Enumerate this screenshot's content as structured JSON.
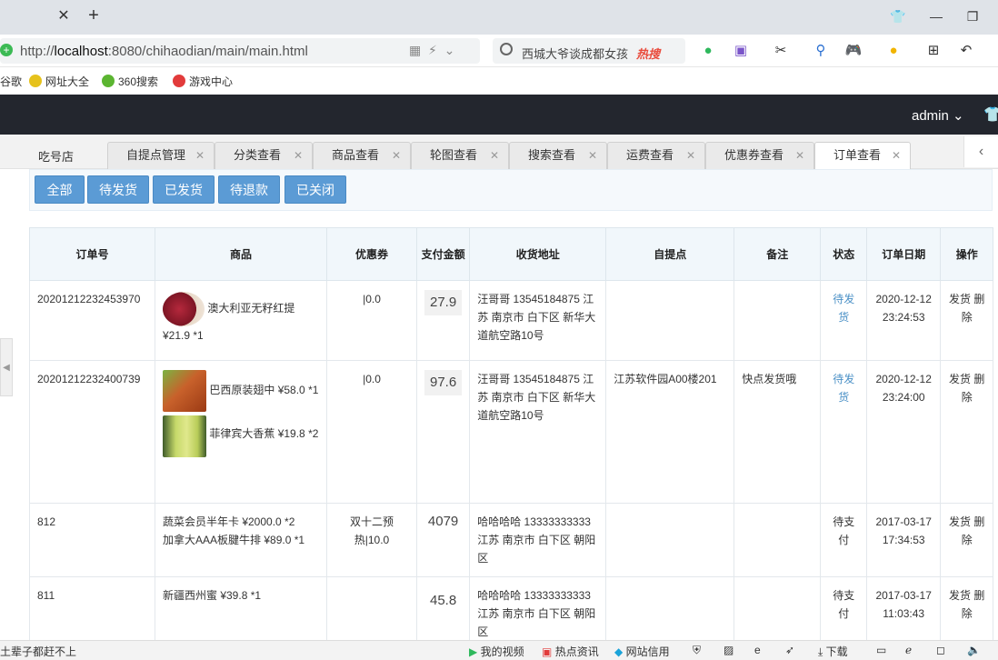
{
  "browser": {
    "url_prefix": "http://",
    "url_host": "localhost",
    "url_rest": ":8080/chihaodian/main/main.html",
    "search_text": "西城大爷谈成都女孩",
    "hot_label": "热搜",
    "bookmarks": [
      "谷歌",
      "网址大全",
      "360搜索",
      "游戏中心"
    ]
  },
  "header": {
    "user": "admin"
  },
  "tabs": {
    "first": "吃号店",
    "items": [
      {
        "label": "自提点管理"
      },
      {
        "label": "分类查看"
      },
      {
        "label": "商品查看"
      },
      {
        "label": "轮图查看"
      },
      {
        "label": "搜索查看"
      },
      {
        "label": "运费查看"
      },
      {
        "label": "优惠券查看"
      },
      {
        "label": "订单查看"
      }
    ]
  },
  "filters": [
    "全部",
    "待发货",
    "已发货",
    "待退款",
    "已关闭"
  ],
  "table": {
    "headers": [
      "订单号",
      "商品",
      "优惠券",
      "支付金额",
      "收货地址",
      "自提点",
      "备注",
      "状态",
      "订单日期",
      "操作"
    ],
    "rows": [
      {
        "order_no": "20201212232453970",
        "products": [
          {
            "name": "澳大利亚无籽红提",
            "price": "¥21.9 *1"
          }
        ],
        "coupon": "|0.0",
        "pay": "27.9",
        "address": "汪哥哥 13545184875 江苏 南京市 白下区 新华大道航空路10号",
        "pickup": "",
        "remark": "",
        "status": "待发货",
        "date": "2020-12-12 23:24:53",
        "ops": "发货 删除"
      },
      {
        "order_no": "20201212232400739",
        "products": [
          {
            "name": "巴西原装翅中",
            "price": "¥58.0 *1"
          },
          {
            "name": "菲律宾大香蕉",
            "price": "¥19.8 *2"
          }
        ],
        "coupon": "|0.0",
        "pay": "97.6",
        "address": "汪哥哥 13545184875 江苏 南京市 白下区 新华大道航空路10号",
        "pickup": "江苏软件园A00楼201",
        "remark": "快点发货哦",
        "status": "待发货",
        "date": "2020-12-12 23:24:00",
        "ops": "发货 删除"
      },
      {
        "order_no": "812",
        "products_text": [
          "蔬菜会员半年卡 ¥2000.0 *2",
          "加拿大AAA板腱牛排 ¥89.0 *1"
        ],
        "coupon": "双十二预热|10.0",
        "pay": "4079",
        "address": "哈哈哈哈 13333333333 江苏 南京市 白下区 朝阳区",
        "pickup": "",
        "remark": "",
        "status": "待支付",
        "date": "2017-03-17 17:34:53",
        "ops": "发货 删除"
      },
      {
        "order_no": "811",
        "products_text": [
          "新疆西州蜜 ¥39.8 *1"
        ],
        "coupon": "",
        "pay": "45.8",
        "address": "哈哈哈哈 13333333333 江苏 南京市 白下区 朝阳区",
        "pickup": "",
        "remark": "",
        "status": "待支付",
        "date": "2017-03-17 11:03:43",
        "ops": "发货 删除"
      }
    ]
  },
  "statusbar": {
    "left": "土辈子都赶不上",
    "items": [
      "我的视频",
      "热点资讯",
      "网站信用",
      "下载"
    ]
  }
}
